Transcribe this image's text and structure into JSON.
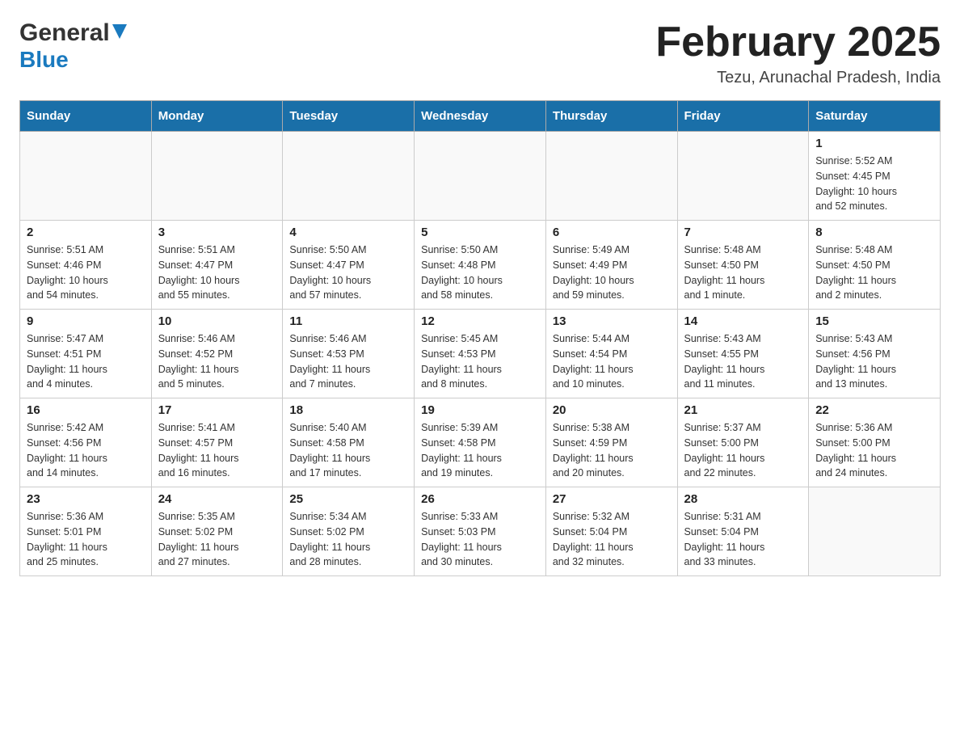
{
  "header": {
    "logo_general": "General",
    "logo_blue": "Blue",
    "month_title": "February 2025",
    "location": "Tezu, Arunachal Pradesh, India"
  },
  "weekdays": [
    "Sunday",
    "Monday",
    "Tuesday",
    "Wednesday",
    "Thursday",
    "Friday",
    "Saturday"
  ],
  "weeks": [
    [
      {
        "day": "",
        "info": ""
      },
      {
        "day": "",
        "info": ""
      },
      {
        "day": "",
        "info": ""
      },
      {
        "day": "",
        "info": ""
      },
      {
        "day": "",
        "info": ""
      },
      {
        "day": "",
        "info": ""
      },
      {
        "day": "1",
        "info": "Sunrise: 5:52 AM\nSunset: 4:45 PM\nDaylight: 10 hours\nand 52 minutes."
      }
    ],
    [
      {
        "day": "2",
        "info": "Sunrise: 5:51 AM\nSunset: 4:46 PM\nDaylight: 10 hours\nand 54 minutes."
      },
      {
        "day": "3",
        "info": "Sunrise: 5:51 AM\nSunset: 4:47 PM\nDaylight: 10 hours\nand 55 minutes."
      },
      {
        "day": "4",
        "info": "Sunrise: 5:50 AM\nSunset: 4:47 PM\nDaylight: 10 hours\nand 57 minutes."
      },
      {
        "day": "5",
        "info": "Sunrise: 5:50 AM\nSunset: 4:48 PM\nDaylight: 10 hours\nand 58 minutes."
      },
      {
        "day": "6",
        "info": "Sunrise: 5:49 AM\nSunset: 4:49 PM\nDaylight: 10 hours\nand 59 minutes."
      },
      {
        "day": "7",
        "info": "Sunrise: 5:48 AM\nSunset: 4:50 PM\nDaylight: 11 hours\nand 1 minute."
      },
      {
        "day": "8",
        "info": "Sunrise: 5:48 AM\nSunset: 4:50 PM\nDaylight: 11 hours\nand 2 minutes."
      }
    ],
    [
      {
        "day": "9",
        "info": "Sunrise: 5:47 AM\nSunset: 4:51 PM\nDaylight: 11 hours\nand 4 minutes."
      },
      {
        "day": "10",
        "info": "Sunrise: 5:46 AM\nSunset: 4:52 PM\nDaylight: 11 hours\nand 5 minutes."
      },
      {
        "day": "11",
        "info": "Sunrise: 5:46 AM\nSunset: 4:53 PM\nDaylight: 11 hours\nand 7 minutes."
      },
      {
        "day": "12",
        "info": "Sunrise: 5:45 AM\nSunset: 4:53 PM\nDaylight: 11 hours\nand 8 minutes."
      },
      {
        "day": "13",
        "info": "Sunrise: 5:44 AM\nSunset: 4:54 PM\nDaylight: 11 hours\nand 10 minutes."
      },
      {
        "day": "14",
        "info": "Sunrise: 5:43 AM\nSunset: 4:55 PM\nDaylight: 11 hours\nand 11 minutes."
      },
      {
        "day": "15",
        "info": "Sunrise: 5:43 AM\nSunset: 4:56 PM\nDaylight: 11 hours\nand 13 minutes."
      }
    ],
    [
      {
        "day": "16",
        "info": "Sunrise: 5:42 AM\nSunset: 4:56 PM\nDaylight: 11 hours\nand 14 minutes."
      },
      {
        "day": "17",
        "info": "Sunrise: 5:41 AM\nSunset: 4:57 PM\nDaylight: 11 hours\nand 16 minutes."
      },
      {
        "day": "18",
        "info": "Sunrise: 5:40 AM\nSunset: 4:58 PM\nDaylight: 11 hours\nand 17 minutes."
      },
      {
        "day": "19",
        "info": "Sunrise: 5:39 AM\nSunset: 4:58 PM\nDaylight: 11 hours\nand 19 minutes."
      },
      {
        "day": "20",
        "info": "Sunrise: 5:38 AM\nSunset: 4:59 PM\nDaylight: 11 hours\nand 20 minutes."
      },
      {
        "day": "21",
        "info": "Sunrise: 5:37 AM\nSunset: 5:00 PM\nDaylight: 11 hours\nand 22 minutes."
      },
      {
        "day": "22",
        "info": "Sunrise: 5:36 AM\nSunset: 5:00 PM\nDaylight: 11 hours\nand 24 minutes."
      }
    ],
    [
      {
        "day": "23",
        "info": "Sunrise: 5:36 AM\nSunset: 5:01 PM\nDaylight: 11 hours\nand 25 minutes."
      },
      {
        "day": "24",
        "info": "Sunrise: 5:35 AM\nSunset: 5:02 PM\nDaylight: 11 hours\nand 27 minutes."
      },
      {
        "day": "25",
        "info": "Sunrise: 5:34 AM\nSunset: 5:02 PM\nDaylight: 11 hours\nand 28 minutes."
      },
      {
        "day": "26",
        "info": "Sunrise: 5:33 AM\nSunset: 5:03 PM\nDaylight: 11 hours\nand 30 minutes."
      },
      {
        "day": "27",
        "info": "Sunrise: 5:32 AM\nSunset: 5:04 PM\nDaylight: 11 hours\nand 32 minutes."
      },
      {
        "day": "28",
        "info": "Sunrise: 5:31 AM\nSunset: 5:04 PM\nDaylight: 11 hours\nand 33 minutes."
      },
      {
        "day": "",
        "info": ""
      }
    ]
  ]
}
